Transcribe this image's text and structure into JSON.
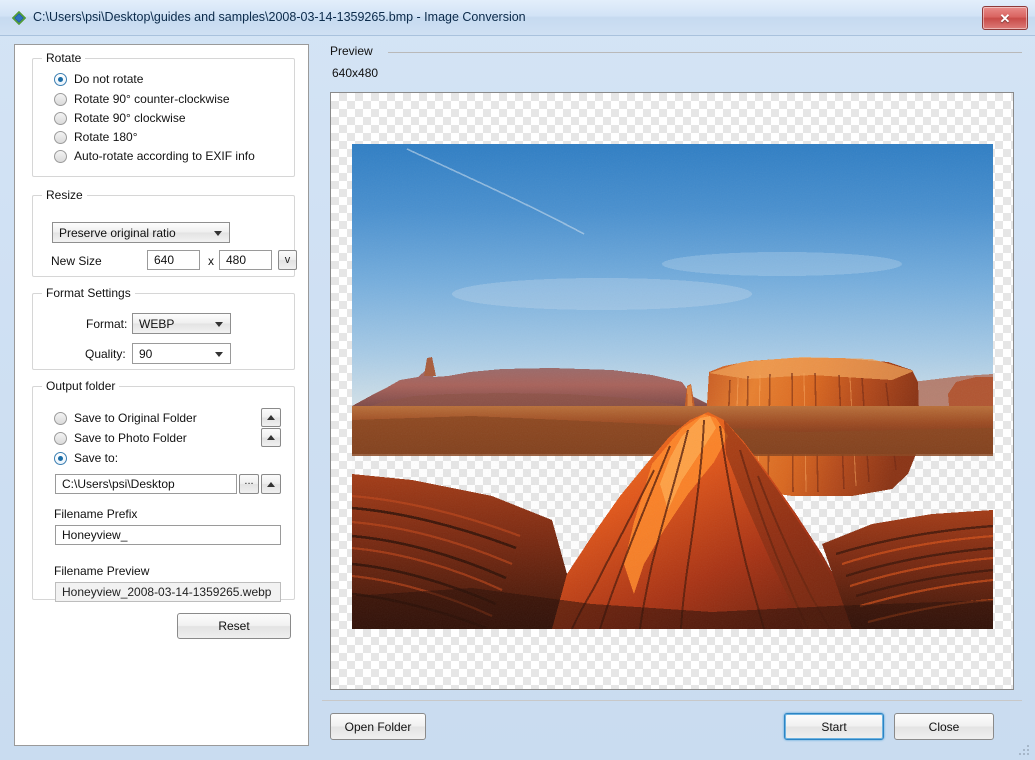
{
  "window": {
    "title": "C:\\Users\\psi\\Desktop\\guides and samples\\2008-03-14-1359265.bmp - Image Conversion",
    "close_label": "✕",
    "accent_blue": "#2c84c4",
    "titlebar_color": "#cfe0f3",
    "close_color": "#c84b48"
  },
  "rotate": {
    "legend": "Rotate",
    "options": [
      {
        "label": "Do not rotate",
        "checked": true
      },
      {
        "label": "Rotate 90° counter-clockwise",
        "checked": false
      },
      {
        "label": "Rotate 90° clockwise",
        "checked": false
      },
      {
        "label": "Rotate 180°",
        "checked": false
      },
      {
        "label": "Auto-rotate according to EXIF info",
        "checked": false
      }
    ]
  },
  "resize": {
    "legend": "Resize",
    "mode_value": "Preserve original ratio",
    "new_size_label": "New Size",
    "width_value": "640",
    "separator": "x",
    "height_value": "480",
    "preset_button": "v"
  },
  "format_settings": {
    "legend": "Format Settings",
    "format_label": "Format:",
    "format_value": "WEBP",
    "quality_label": "Quality:",
    "quality_value": "90"
  },
  "output_folder": {
    "legend": "Output folder",
    "options": [
      {
        "label": "Save to Original Folder",
        "checked": false
      },
      {
        "label": "Save to Photo Folder",
        "checked": false
      },
      {
        "label": "Save to:",
        "checked": true
      }
    ],
    "path_value": "C:\\Users\\psi\\Desktop",
    "browse_button": "...",
    "filename_prefix_label": "Filename Prefix",
    "filename_prefix_value": "Honeyview_",
    "filename_preview_label": "Filename Preview",
    "filename_preview_value": "Honeyview_2008-03-14-1359265.webp"
  },
  "reset_button": "Reset",
  "preview": {
    "legend": "Preview",
    "dimensions": "640x480"
  },
  "footer": {
    "open_folder": "Open Folder",
    "start": "Start",
    "close": "Close"
  }
}
